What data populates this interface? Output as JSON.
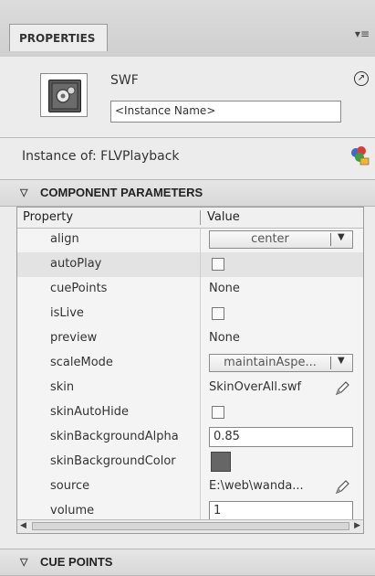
{
  "panel": {
    "tab_label": "PROPERTIES",
    "menu_icon": "panel-menu-icon"
  },
  "instance": {
    "type_label": "SWF",
    "name_placeholder": "<Instance Name>",
    "instance_of": "Instance of: FLVPlayback"
  },
  "sections": {
    "component_parameters": "COMPONENT PARAMETERS",
    "cue_points": "CUE POINTS"
  },
  "grid": {
    "col_property": "Property",
    "col_value": "Value",
    "rows": [
      {
        "name": "align",
        "kind": "dropdown",
        "value": "center"
      },
      {
        "name": "autoPlay",
        "kind": "checkbox",
        "checked": false
      },
      {
        "name": "cuePoints",
        "kind": "text",
        "value": "None"
      },
      {
        "name": "isLive",
        "kind": "checkbox",
        "checked": false
      },
      {
        "name": "preview",
        "kind": "text",
        "value": "None"
      },
      {
        "name": "scaleMode",
        "kind": "dropdown",
        "value": "maintainAspe..."
      },
      {
        "name": "skin",
        "kind": "text-edit",
        "value": "SkinOverAll.swf"
      },
      {
        "name": "skinAutoHide",
        "kind": "checkbox",
        "checked": false
      },
      {
        "name": "skinBackgroundAlpha",
        "kind": "input",
        "value": "0.85"
      },
      {
        "name": "skinBackgroundColor",
        "kind": "color",
        "value": "#666666"
      },
      {
        "name": "source",
        "kind": "text-edit",
        "value": "E:\\web\\wanda..."
      },
      {
        "name": "volume",
        "kind": "input",
        "value": "1"
      }
    ]
  },
  "colors": {
    "panel_bg": "#ececec",
    "swatch": "#666666"
  }
}
